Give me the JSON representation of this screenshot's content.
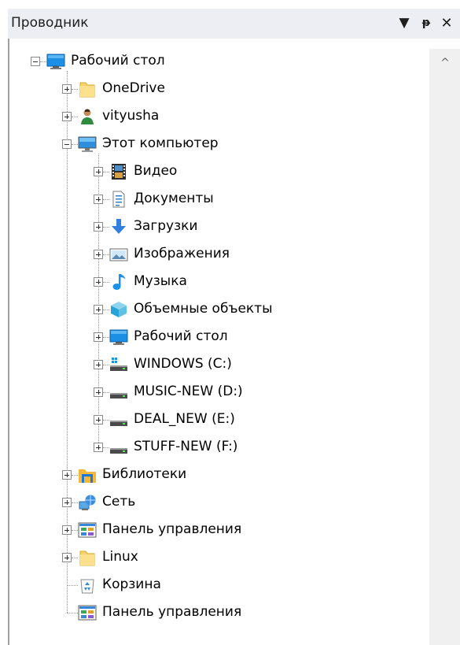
{
  "panel": {
    "title": "Проводник",
    "buttons": {
      "dropdown": "▼",
      "pin": "ᵽ",
      "close": "✕"
    }
  },
  "tree": {
    "root": {
      "label": "Рабочий стол",
      "icon": "desktop-icon",
      "expanded": true,
      "children": [
        {
          "label": "OneDrive",
          "icon": "folder-icon"
        },
        {
          "label": "vityusha",
          "icon": "user-icon"
        },
        {
          "label": "Этот компьютер",
          "icon": "computer-icon",
          "expanded": true,
          "children": [
            {
              "label": "Видео",
              "icon": "video-icon"
            },
            {
              "label": "Документы",
              "icon": "documents-icon"
            },
            {
              "label": "Загрузки",
              "icon": "downloads-icon"
            },
            {
              "label": "Изображения",
              "icon": "pictures-icon"
            },
            {
              "label": "Музыка",
              "icon": "music-icon"
            },
            {
              "label": "Объемные объекты",
              "icon": "3d-objects-icon"
            },
            {
              "label": "Рабочий стол",
              "icon": "desktop-icon"
            },
            {
              "label": "WINDOWS (C:)",
              "icon": "windows-drive-icon"
            },
            {
              "label": "MUSIC-NEW (D:)",
              "icon": "drive-icon"
            },
            {
              "label": "DEAL_NEW (E:)",
              "icon": "drive-icon"
            },
            {
              "label": "STUFF-NEW (F:)",
              "icon": "drive-icon"
            }
          ]
        },
        {
          "label": "Библиотеки",
          "icon": "libraries-icon"
        },
        {
          "label": "Сеть",
          "icon": "network-icon"
        },
        {
          "label": "Панель управления",
          "icon": "control-panel-icon"
        },
        {
          "label": "Linux",
          "icon": "folder-icon"
        },
        {
          "label": "Корзина",
          "icon": "recycle-bin-icon",
          "leaf": true
        },
        {
          "label": "Панель управления",
          "icon": "control-panel-icon",
          "leaf": true
        }
      ]
    }
  },
  "scrollbar": {
    "up_arrow": "^"
  }
}
